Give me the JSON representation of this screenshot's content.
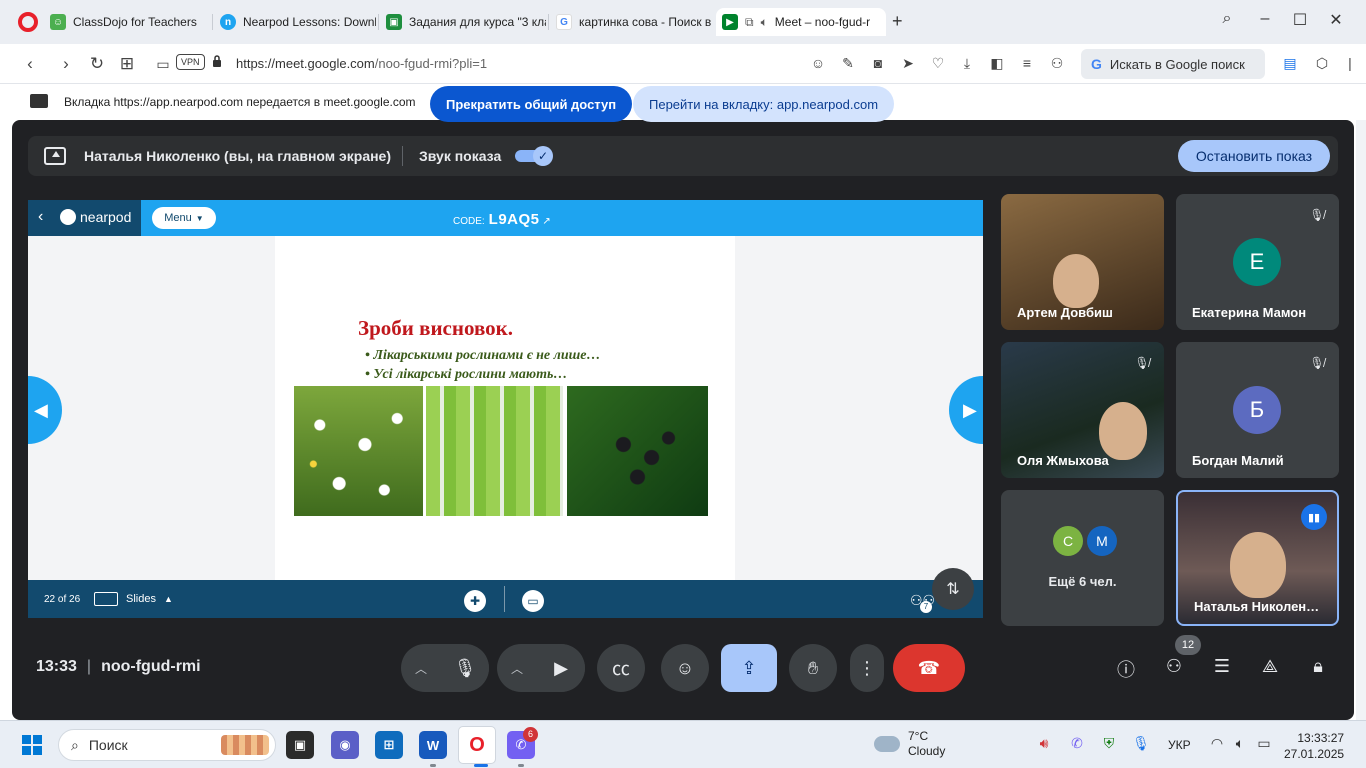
{
  "browser": {
    "tabs": [
      {
        "label": "ClassDojo for Teachers",
        "icon": "classdojo-icon",
        "color": "#4caf50"
      },
      {
        "label": "Nearpod Lessons: Downlo",
        "icon": "nearpod-icon",
        "color": "#1ea4f0"
      },
      {
        "label": "Задания для курса \"3 кла",
        "icon": "classroom-icon",
        "color": "#1e8e3e"
      },
      {
        "label": "картинка сова - Поиск в",
        "icon": "google-icon",
        "color": "#4285f4"
      },
      {
        "label": "Meet – noo-fgud-r",
        "icon": "meet-icon",
        "color": "#00832d"
      }
    ],
    "url_host": "https://meet.google.com",
    "url_path": "/noo-fgud-rmi?pli=1",
    "vpn_label": "VPN",
    "google_search_label": "Искать в Google поиск",
    "share_notice": "Вкладка https://app.nearpod.com передается в meet.google.com",
    "stop_share_label": "Прекратить общий доступ",
    "goto_tab_label": "Перейти на вкладку: app.nearpod.com"
  },
  "meet": {
    "presenting_text": "Наталья Николенко (вы, на главном экране)",
    "audio_label": "Звук показа",
    "stop_present_label": "Остановить показ",
    "time": "13:33",
    "meeting_code": "noo-fgud-rmi",
    "participants_badge": "12",
    "tiles": [
      {
        "name": "Артем Довбиш",
        "type": "video"
      },
      {
        "name": "Екатерина Мамон",
        "initial": "Е",
        "avatar_color": "#00897b",
        "muted": true
      },
      {
        "name": "Оля Жмыхова",
        "type": "video",
        "muted": true
      },
      {
        "name": "Богдан Малий",
        "initial": "Б",
        "avatar_color": "#5c6bc0",
        "muted": true
      },
      {
        "more": "Ещё 6 чел.",
        "avatars": [
          {
            "initial": "С",
            "color": "#7cb342"
          },
          {
            "initial": "М",
            "color": "#1565c0"
          }
        ]
      },
      {
        "name": "Наталья Николен…",
        "type": "video",
        "speaking": true
      }
    ]
  },
  "nearpod": {
    "menu_label": "Menu",
    "code_label": "CODE:",
    "code_value": "L9AQ5",
    "brand": "nearpod",
    "slide_title": "Зроби висновок.",
    "bullets": [
      "• Лікарськими рослинами є не лише…",
      "• Усі лікарські рослини мають…"
    ],
    "page": "22 of 26",
    "slides_label": "Slides",
    "people_count": "7"
  },
  "taskbar": {
    "search_placeholder": "Поиск",
    "weather_temp": "7°C",
    "weather_desc": "Cloudy",
    "lang": "УКР",
    "time": "13:33:27",
    "date": "27.01.2025",
    "viber_badge": "6"
  }
}
